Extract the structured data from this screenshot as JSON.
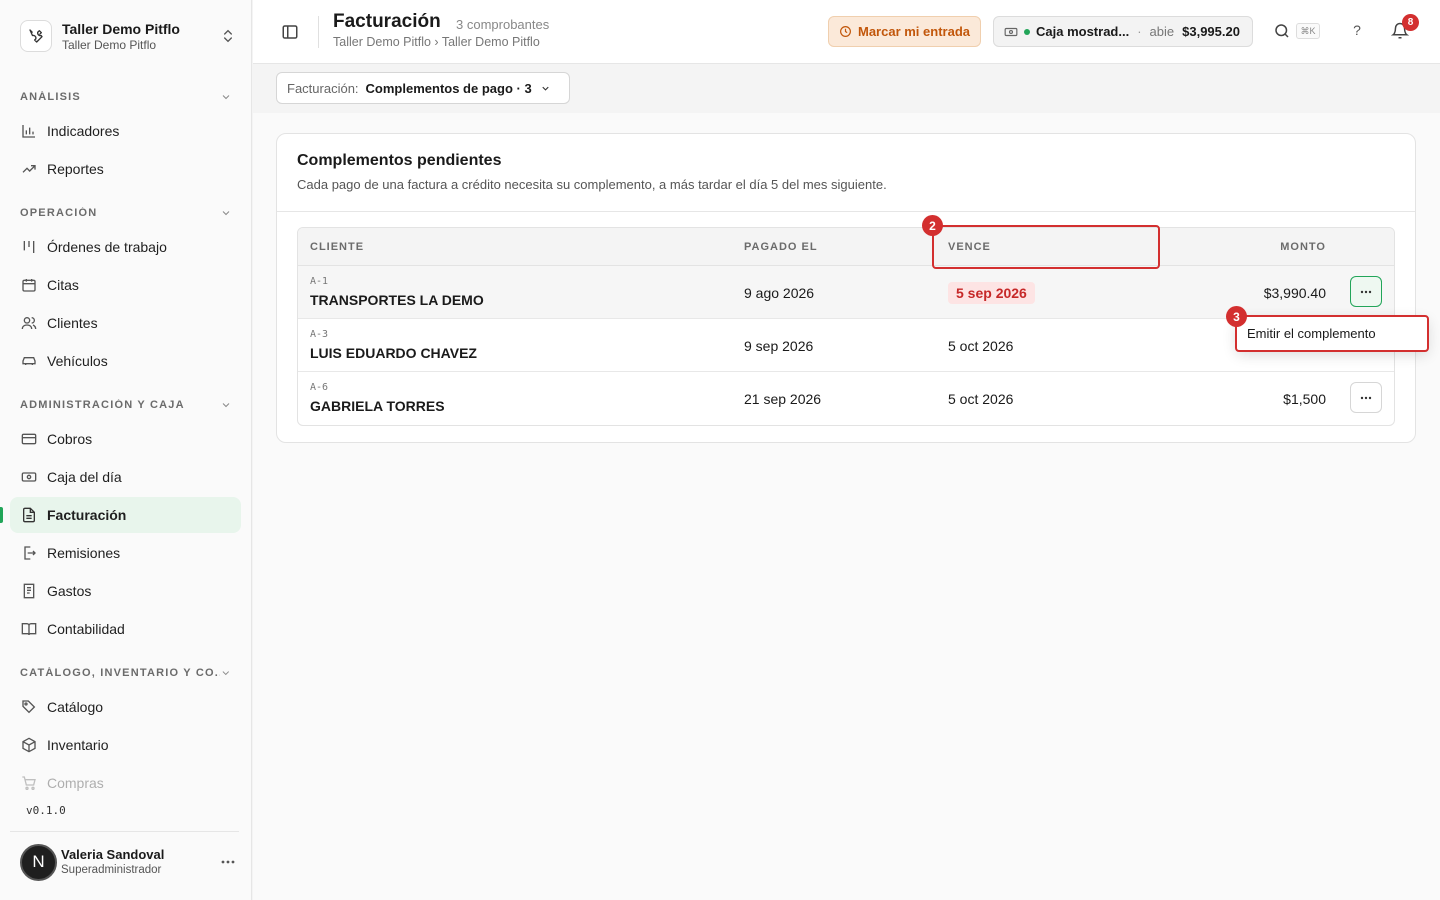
{
  "org": {
    "name": "Taller Demo Pitflo",
    "subtitle": "Taller Demo Pitflo",
    "logo_icon": "wrench-icon"
  },
  "sidebar": {
    "sections": [
      {
        "label": "ANÁLISIS"
      },
      {
        "label": "OPERACIÓN"
      },
      {
        "label": "ADMINISTRACIÓN Y CAJA"
      },
      {
        "label": "CATÁLOGO, INVENTARIO Y CO..."
      }
    ],
    "items": [
      {
        "label": "Indicadores",
        "icon": "bar-chart-icon"
      },
      {
        "label": "Reportes",
        "icon": "trend-up-icon"
      },
      {
        "label": "Órdenes de trabajo",
        "icon": "kanban-icon"
      },
      {
        "label": "Citas",
        "icon": "calendar-icon"
      },
      {
        "label": "Clientes",
        "icon": "users-icon"
      },
      {
        "label": "Vehículos",
        "icon": "car-icon"
      },
      {
        "label": "Cobros",
        "icon": "credit-card-icon"
      },
      {
        "label": "Caja del día",
        "icon": "cash-icon"
      },
      {
        "label": "Facturación",
        "icon": "document-icon",
        "active": true
      },
      {
        "label": "Remisiones",
        "icon": "file-export-icon"
      },
      {
        "label": "Gastos",
        "icon": "receipt-icon"
      },
      {
        "label": "Contabilidad",
        "icon": "book-icon"
      },
      {
        "label": "Catálogo",
        "icon": "tag-icon"
      },
      {
        "label": "Inventario",
        "icon": "box-icon"
      },
      {
        "label": "Compras",
        "icon": "cart-icon"
      }
    ],
    "version": "v0.1.0"
  },
  "user": {
    "initial": "N",
    "name": "Valeria Sandoval",
    "role": "Superadministrador"
  },
  "header": {
    "title": "Facturación",
    "count": "3 comprobantes",
    "breadcrumb": "Taller Demo Pitflo › Taller Demo Pitflo",
    "entrada_label": "Marcar mi entrada",
    "caja": {
      "name": "Caja mostrad...",
      "separator": "·",
      "status": "abie",
      "amount": "$3,995.20"
    },
    "search_shortcut": "⌘K",
    "help_label": "?",
    "notifications": "8"
  },
  "filter": {
    "label": "Facturación:",
    "value": "Complementos de pago · 3"
  },
  "card": {
    "title": "Complementos pendientes",
    "subtitle": "Cada pago de una factura a crédito necesita su complemento, a más tardar el día 5 del mes siguiente."
  },
  "table": {
    "headers": {
      "cliente": "CLIENTE",
      "pagado": "PAGADO EL",
      "vence": "VENCE",
      "monto": "MONTO"
    },
    "rows": [
      {
        "code": "A-1",
        "cliente": "TRANSPORTES LA DEMO",
        "pagado": "9 ago 2026",
        "vence": "5 sep 2026",
        "monto": "$3,990.40",
        "overdue": true
      },
      {
        "code": "A-3",
        "cliente": "LUIS EDUARDO CHAVEZ",
        "pagado": "9 sep 2026",
        "vence": "5 oct 2026",
        "monto": ""
      },
      {
        "code": "A-6",
        "cliente": "GABRIELA TORRES",
        "pagado": "21 sep 2026",
        "vence": "5 oct 2026",
        "monto": "$1,500"
      }
    ]
  },
  "menu": {
    "items": [
      {
        "label": "Emitir el complemento"
      }
    ]
  },
  "annotations": [
    {
      "number": "2"
    },
    {
      "number": "3"
    }
  ],
  "colors": {
    "accent": "#22a559",
    "annotation": "#d32f2f",
    "warning": "#c2570b"
  }
}
